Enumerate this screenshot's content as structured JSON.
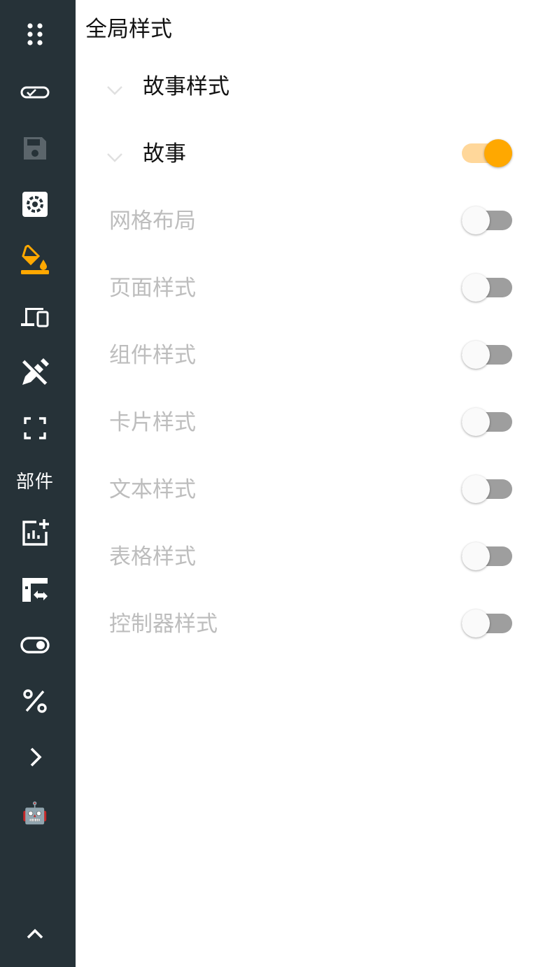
{
  "sidebar": {
    "items": [
      {
        "name": "dots-grid-icon"
      },
      {
        "name": "ticket-check-icon"
      },
      {
        "name": "save-icon"
      },
      {
        "name": "settings-box-icon"
      },
      {
        "name": "paint-bucket-icon",
        "active": true
      },
      {
        "name": "devices-icon"
      },
      {
        "name": "design-tools-icon"
      },
      {
        "name": "fullscreen-icon"
      },
      {
        "label": "部件"
      },
      {
        "name": "add-chart-icon"
      },
      {
        "name": "table-swap-icon"
      },
      {
        "name": "toggle-icon"
      },
      {
        "name": "percent-icon"
      },
      {
        "name": "chevron-right-icon"
      },
      {
        "name": "robot-emoji-icon",
        "glyph": "🤖"
      },
      {
        "name": "chevron-up-icon"
      }
    ]
  },
  "panel": {
    "title": "全局样式",
    "sections": [
      {
        "label": "故事样式",
        "expandable": true
      },
      {
        "label": "故事",
        "expandable": true,
        "toggle": true
      }
    ],
    "options": [
      {
        "label": "网格布局",
        "toggle": false
      },
      {
        "label": "页面样式",
        "toggle": false
      },
      {
        "label": "组件样式",
        "toggle": false
      },
      {
        "label": "卡片样式",
        "toggle": false
      },
      {
        "label": "文本样式",
        "toggle": false
      },
      {
        "label": "表格样式",
        "toggle": false
      },
      {
        "label": "控制器样式",
        "toggle": false
      }
    ]
  },
  "colors": {
    "sidebar_bg": "#263238",
    "accent": "#FFA800",
    "accent_track": "#FFD79A",
    "disabled_text": "#BDBDBD"
  }
}
